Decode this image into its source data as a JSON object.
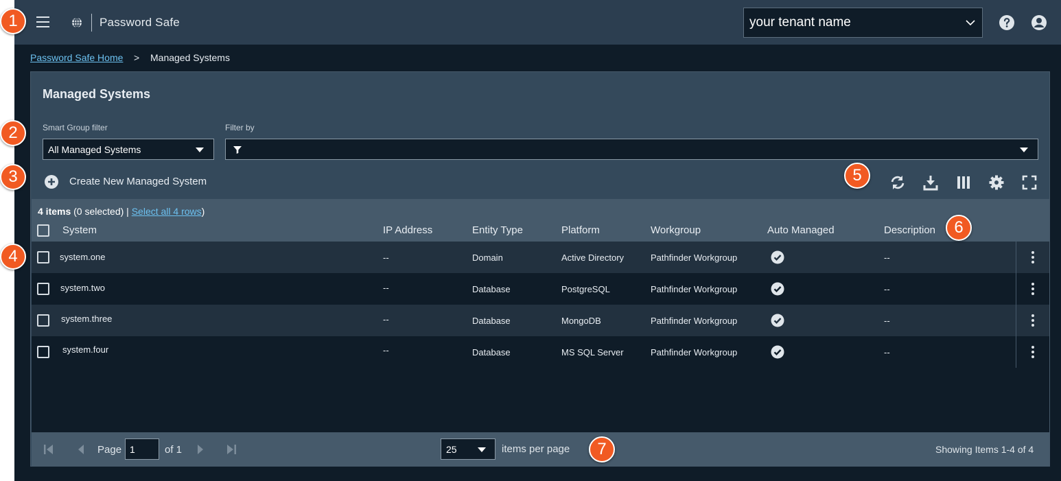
{
  "app": {
    "brand_name": "Password Safe",
    "tenant": "your tenant name"
  },
  "breadcrumb": {
    "home": "Password Safe Home",
    "separator": ">",
    "current": "Managed Systems"
  },
  "panel": {
    "title": "Managed Systems",
    "smart_group_label": "Smart Group filter",
    "smart_group_value": "All Managed Systems",
    "filter_label": "Filter by",
    "filter_value": "",
    "create_label": "Create New Managed System"
  },
  "toolbar_icons": [
    "refresh-icon",
    "download-icon",
    "columns-icon",
    "settings-icon",
    "fullscreen-icon"
  ],
  "grid": {
    "count_bold": "4 items",
    "count_selected": " (0 selected) | ",
    "select_all": "Select all 4 rows",
    "count_close": ")",
    "columns": [
      "System",
      "IP Address",
      "Entity Type",
      "Platform",
      "Workgroup",
      "Auto Managed",
      "Description"
    ],
    "rows": [
      {
        "system": "system.one",
        "ip": "--",
        "entity": "Domain",
        "platform": "Active Directory",
        "workgroup": "Pathfinder Workgroup",
        "auto_managed": true,
        "description": "--"
      },
      {
        "system": "system.two",
        "ip": "--",
        "entity": "Database",
        "platform": "PostgreSQL",
        "workgroup": "Pathfinder Workgroup",
        "auto_managed": true,
        "description": "--"
      },
      {
        "system": "system.three",
        "ip": "--",
        "entity": "Database",
        "platform": "MongoDB",
        "workgroup": "Pathfinder Workgroup",
        "auto_managed": true,
        "description": "--"
      },
      {
        "system": "system.four",
        "ip": "--",
        "entity": "Database",
        "platform": "MS SQL Server",
        "workgroup": "Pathfinder Workgroup",
        "auto_managed": true,
        "description": "--"
      }
    ]
  },
  "pager": {
    "page_label": "Page",
    "page_value": "1",
    "of_label": "of 1",
    "per_page": "25",
    "per_page_label": "items per page",
    "showing": "Showing Items 1-4 of 4"
  },
  "callouts": [
    "1",
    "2",
    "3",
    "4",
    "5",
    "6",
    "7"
  ],
  "colors": {
    "accent": "#6cc1f0",
    "callout": "#f15a22",
    "topbar": "#2c3e50",
    "panel": "#34495b"
  }
}
